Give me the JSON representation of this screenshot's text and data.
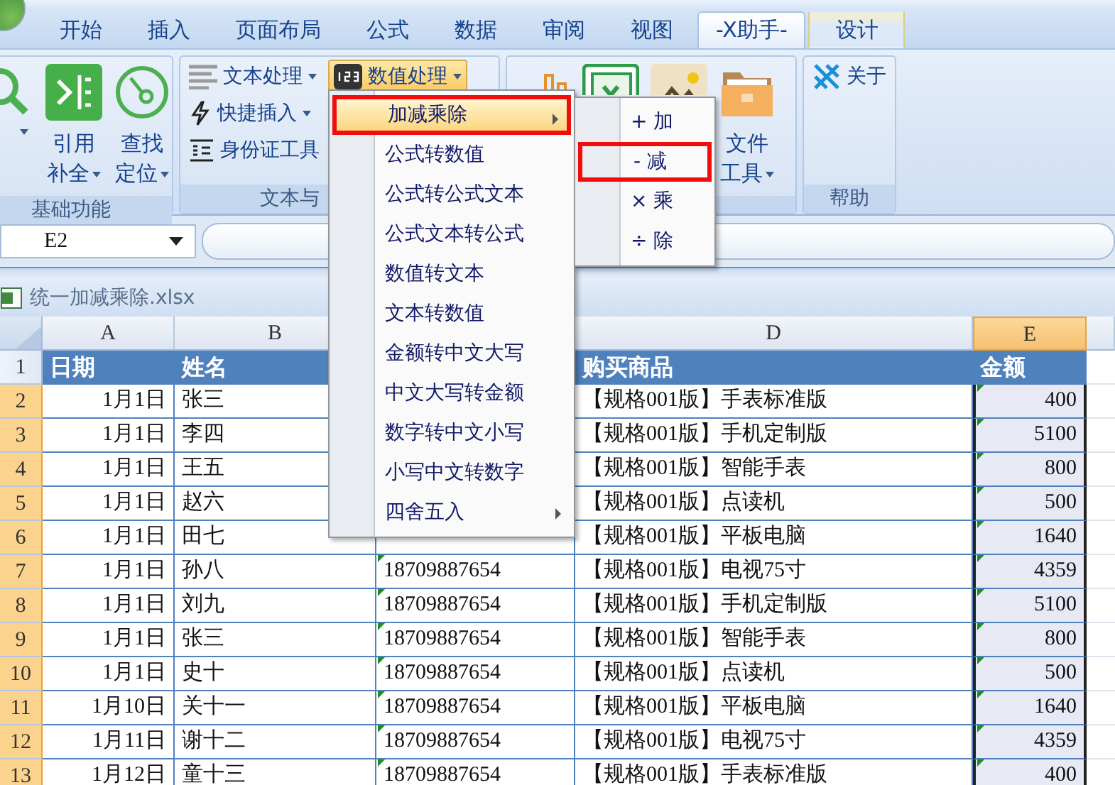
{
  "tabs": [
    {
      "label": "开始",
      "selected": false,
      "kind": "normal"
    },
    {
      "label": "插入",
      "selected": false,
      "kind": "normal"
    },
    {
      "label": "页面布局",
      "selected": false,
      "kind": "normal"
    },
    {
      "label": "公式",
      "selected": false,
      "kind": "normal"
    },
    {
      "label": "数据",
      "selected": false,
      "kind": "normal"
    },
    {
      "label": "审阅",
      "selected": false,
      "kind": "normal"
    },
    {
      "label": "视图",
      "selected": false,
      "kind": "normal"
    },
    {
      "label": "-X助手-",
      "selected": true,
      "kind": "normal"
    },
    {
      "label": "设计",
      "selected": false,
      "kind": "contextual"
    }
  ],
  "ribbon": {
    "groups": [
      {
        "label": "基础功能",
        "columns": [
          [
            {
              "kind": "large",
              "dropdown": true,
              "active": false
            }
          ],
          [
            {
              "kind": "large",
              "lines": [
                "引用",
                "补全"
              ],
              "dropdown": true,
              "active": false
            }
          ],
          [
            {
              "kind": "large",
              "lines": [
                "查找",
                "定位"
              ],
              "dropdown": true,
              "active": false
            }
          ]
        ]
      },
      {
        "label": "文本与",
        "columns": [
          [
            {
              "kind": "small",
              "lines": [
                "文本处理"
              ],
              "dropdown": true,
              "active": false
            },
            {
              "kind": "small",
              "lines": [
                "快捷插入"
              ],
              "dropdown": true,
              "active": false
            },
            {
              "kind": "small",
              "lines": [
                "身份证工具"
              ],
              "dropdown": false,
              "active": false
            }
          ],
          [
            {
              "kind": "small",
              "lines": [
                "数值处理"
              ],
              "dropdown": true,
              "active": true
            }
          ]
        ]
      },
      {
        "columns": [
          [
            {
              "kind": "large",
              "dropdown": false,
              "active": false
            }
          ],
          [
            {
              "kind": "large",
              "dropdown": false,
              "active": false
            }
          ],
          [
            {
              "kind": "large",
              "dropdown": false,
              "active": false
            }
          ],
          [
            {
              "kind": "large",
              "lines": [
                "文件",
                "工具"
              ],
              "dropdown": true,
              "active": false
            }
          ]
        ]
      },
      {
        "label": "帮助",
        "columns": [
          [
            {
              "kind": "small",
              "lines": [
                "关于"
              ],
              "dropdown": false,
              "active": false
            }
          ]
        ]
      }
    ]
  },
  "name_box": "E2",
  "workbook_title": "统一加减乘除.xlsx",
  "sheet": {
    "columns": [
      {
        "label": "A",
        "selected": false,
        "flagged": false,
        "kind": "number"
      },
      {
        "label": "B",
        "selected": false,
        "flagged": false,
        "kind": "text"
      },
      {
        "selected": false,
        "flagged": true,
        "kind": "text"
      },
      {
        "label": "D",
        "selected": false,
        "flagged": false,
        "kind": "text"
      },
      {
        "label": "E",
        "selected": true,
        "flagged": true,
        "kind": "number"
      }
    ],
    "rows": [
      {
        "header": "1",
        "selected": false,
        "kind": "heading",
        "cells": [
          "日期",
          "姓名",
          null,
          "购买商品",
          "金额"
        ]
      },
      {
        "header": "2",
        "selected": true,
        "kind": "data",
        "cells": [
          "1月1日",
          "张三",
          null,
          "【规格001版】手表标准版",
          "400"
        ]
      },
      {
        "header": "3",
        "selected": true,
        "kind": "data",
        "cells": [
          "1月1日",
          "李四",
          null,
          "【规格001版】手机定制版",
          "5100"
        ]
      },
      {
        "header": "4",
        "selected": true,
        "kind": "data",
        "cells": [
          "1月1日",
          "王五",
          null,
          "【规格001版】智能手表",
          "800"
        ]
      },
      {
        "header": "5",
        "selected": true,
        "kind": "data",
        "cells": [
          "1月1日",
          "赵六",
          null,
          "【规格001版】点读机",
          "500"
        ]
      },
      {
        "header": "6",
        "selected": true,
        "kind": "data",
        "cells": [
          "1月1日",
          "田七",
          null,
          "【规格001版】平板电脑",
          "1640"
        ]
      },
      {
        "header": "7",
        "selected": true,
        "kind": "data",
        "cells": [
          "1月1日",
          "孙八",
          "18709887654",
          "【规格001版】电视75寸",
          "4359"
        ]
      },
      {
        "header": "8",
        "selected": true,
        "kind": "data",
        "cells": [
          "1月1日",
          "刘九",
          "18709887654",
          "【规格001版】手机定制版",
          "5100"
        ]
      },
      {
        "header": "9",
        "selected": true,
        "kind": "data",
        "cells": [
          "1月1日",
          "张三",
          "18709887654",
          "【规格001版】智能手表",
          "800"
        ]
      },
      {
        "header": "10",
        "selected": true,
        "kind": "data",
        "cells": [
          "1月1日",
          "史十",
          "18709887654",
          "【规格001版】点读机",
          "500"
        ]
      },
      {
        "header": "11",
        "selected": true,
        "kind": "data",
        "cells": [
          "1月10日",
          "关十一",
          "18709887654",
          "【规格001版】平板电脑",
          "1640"
        ]
      },
      {
        "header": "12",
        "selected": true,
        "kind": "data",
        "cells": [
          "1月11日",
          "谢十二",
          "18709887654",
          "【规格001版】电视75寸",
          "4359"
        ]
      },
      {
        "header": "13",
        "selected": true,
        "kind": "data",
        "cells": [
          "1月12日",
          "童十三",
          "18709887654",
          "【规格001版】手表标准版",
          "400"
        ]
      }
    ]
  },
  "menu": {
    "items": [
      {
        "label": "加减乘除",
        "submenu": true,
        "selected": true,
        "outlined": true
      },
      {
        "label": "公式转数值",
        "submenu": false,
        "selected": false,
        "outlined": false
      },
      {
        "label": "公式转公式文本",
        "submenu": false,
        "selected": false,
        "outlined": false
      },
      {
        "label": "公式文本转公式",
        "submenu": false,
        "selected": false,
        "outlined": false
      },
      {
        "label": "数值转文本",
        "submenu": false,
        "selected": false,
        "outlined": false
      },
      {
        "label": "文本转数值",
        "submenu": false,
        "selected": false,
        "outlined": false
      },
      {
        "label": "金额转中文大写",
        "submenu": false,
        "selected": false,
        "outlined": false
      },
      {
        "label": "中文大写转金额",
        "submenu": false,
        "selected": false,
        "outlined": false
      },
      {
        "label": "数字转中文小写",
        "submenu": false,
        "selected": false,
        "outlined": false
      },
      {
        "label": "小写中文转数字",
        "submenu": false,
        "selected": false,
        "outlined": false
      },
      {
        "label": "四舍五入",
        "submenu": true,
        "selected": false,
        "outlined": false
      }
    ]
  },
  "submenu": {
    "items": [
      {
        "label": "+ 加",
        "selected": false,
        "outlined": false
      },
      {
        "label": "- 减",
        "selected": false,
        "outlined": true
      },
      {
        "label": "× 乘",
        "selected": false,
        "outlined": false
      },
      {
        "label": "÷ 除",
        "selected": false,
        "outlined": false
      }
    ]
  }
}
